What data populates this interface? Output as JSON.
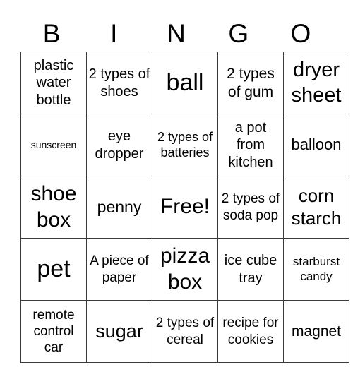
{
  "header": {
    "letters": [
      "B",
      "I",
      "N",
      "G",
      "O"
    ]
  },
  "board": {
    "rows": [
      [
        {
          "text": "plastic water bottle",
          "size": "m"
        },
        {
          "text": "2 types of shoes",
          "size": "m"
        },
        {
          "text": "ball",
          "size": "xl"
        },
        {
          "text": "2 types of gum",
          "size": "m"
        },
        {
          "text": "dryer sheet",
          "size": "l"
        }
      ],
      [
        {
          "text": "sunscreen",
          "size": "xs"
        },
        {
          "text": "eye dropper",
          "size": "m"
        },
        {
          "text": "2 types of batteries",
          "size": "s"
        },
        {
          "text": "a pot from kitchen",
          "size": "m"
        },
        {
          "text": "balloon",
          "size": "m"
        }
      ],
      [
        {
          "text": "shoe box",
          "size": "l"
        },
        {
          "text": "penny",
          "size": "m"
        },
        {
          "text": "Free!",
          "size": "l"
        },
        {
          "text": "2 types of soda pop",
          "size": "s"
        },
        {
          "text": "corn starch",
          "size": "l"
        }
      ],
      [
        {
          "text": "pet",
          "size": "xl"
        },
        {
          "text": "A piece of paper",
          "size": "s"
        },
        {
          "text": "pizza box",
          "size": "l"
        },
        {
          "text": "ice cube tray",
          "size": "m"
        },
        {
          "text": "starburst candy",
          "size": "s"
        }
      ],
      [
        {
          "text": "remote control car",
          "size": "s"
        },
        {
          "text": "sugar",
          "size": "l"
        },
        {
          "text": "2 types of cereal",
          "size": "s"
        },
        {
          "text": "recipe for cookies",
          "size": "s"
        },
        {
          "text": "magnet",
          "size": "m"
        }
      ]
    ]
  }
}
